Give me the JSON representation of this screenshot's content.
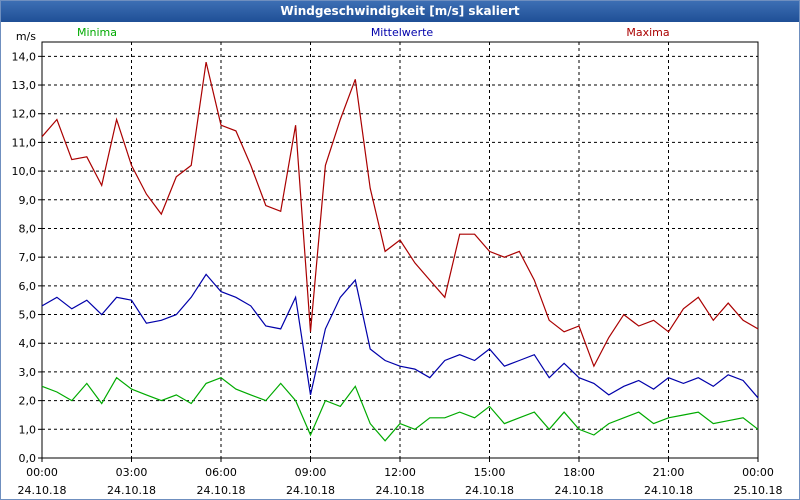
{
  "window": {
    "title": "Windgeschwindigkeit [m/s] skaliert"
  },
  "chart_data": {
    "type": "line",
    "title": "Windgeschwindigkeit [m/s] skaliert",
    "ylabel": "m/s",
    "ylim": [
      0,
      14.5
    ],
    "grid": true,
    "y_ticks": [
      "0,0",
      "1,0",
      "2,0",
      "3,0",
      "4,0",
      "5,0",
      "6,0",
      "7,0",
      "8,0",
      "9,0",
      "10,0",
      "11,0",
      "12,0",
      "13,0",
      "14,0"
    ],
    "x_ticks": [
      {
        "time": "00:00",
        "date": "24.10.18"
      },
      {
        "time": "03:00",
        "date": "24.10.18"
      },
      {
        "time": "06:00",
        "date": "24.10.18"
      },
      {
        "time": "09:00",
        "date": "24.10.18"
      },
      {
        "time": "12:00",
        "date": "24.10.18"
      },
      {
        "time": "15:00",
        "date": "24.10.18"
      },
      {
        "time": "18:00",
        "date": "24.10.18"
      },
      {
        "time": "21:00",
        "date": "24.10.18"
      },
      {
        "time": "00:00",
        "date": "25.10.18"
      }
    ],
    "x_hours": [
      0,
      0.5,
      1,
      1.5,
      2,
      2.5,
      3,
      3.5,
      4,
      4.5,
      5,
      5.5,
      6,
      6.5,
      7,
      7.5,
      8,
      8.5,
      9,
      9.5,
      10,
      10.5,
      11,
      11.5,
      12,
      12.5,
      13,
      13.5,
      14,
      14.5,
      15,
      15.5,
      16,
      16.5,
      17,
      17.5,
      18,
      18.5,
      19,
      19.5,
      20,
      20.5,
      21,
      21.5,
      22,
      22.5,
      23,
      23.5,
      24
    ],
    "series": [
      {
        "name": "Minima",
        "color": "#00aa00",
        "values": [
          2.5,
          2.3,
          2.0,
          2.6,
          1.9,
          2.8,
          2.4,
          2.2,
          2.0,
          2.2,
          1.9,
          2.6,
          2.8,
          2.4,
          2.2,
          2.0,
          2.6,
          2.0,
          0.8,
          2.0,
          1.8,
          2.5,
          1.2,
          0.6,
          1.2,
          1.0,
          1.4,
          1.4,
          1.6,
          1.4,
          1.8,
          1.2,
          1.4,
          1.6,
          1.0,
          1.6,
          1.0,
          0.8,
          1.2,
          1.4,
          1.6,
          1.2,
          1.4,
          1.5,
          1.6,
          1.2,
          1.3,
          1.4,
          1.0
        ]
      },
      {
        "name": "Mittelwerte",
        "color": "#0000aa",
        "values": [
          5.3,
          5.6,
          5.2,
          5.5,
          5.0,
          5.6,
          5.5,
          4.7,
          4.8,
          5.0,
          5.6,
          6.4,
          5.8,
          5.6,
          5.3,
          4.6,
          4.5,
          5.6,
          2.2,
          4.5,
          5.6,
          6.2,
          3.8,
          3.4,
          3.2,
          3.1,
          2.8,
          3.4,
          3.6,
          3.4,
          3.8,
          3.2,
          3.4,
          3.6,
          2.8,
          3.3,
          2.8,
          2.6,
          2.2,
          2.5,
          2.7,
          2.4,
          2.8,
          2.6,
          2.8,
          2.5,
          2.9,
          2.7,
          2.1
        ]
      },
      {
        "name": "Maxima",
        "color": "#aa0000",
        "values": [
          11.2,
          11.8,
          10.4,
          10.5,
          9.5,
          11.8,
          10.2,
          9.2,
          8.5,
          9.8,
          10.2,
          13.8,
          11.6,
          11.4,
          10.2,
          8.8,
          8.6,
          11.6,
          4.4,
          10.2,
          11.8,
          13.2,
          9.4,
          7.2,
          7.6,
          6.8,
          6.2,
          5.6,
          7.8,
          7.8,
          7.2,
          7.0,
          7.2,
          6.2,
          4.8,
          4.4,
          4.6,
          3.2,
          4.2,
          5.0,
          4.6,
          4.8,
          4.4,
          5.2,
          5.6,
          4.8,
          5.4,
          4.8,
          4.5
        ]
      }
    ]
  }
}
